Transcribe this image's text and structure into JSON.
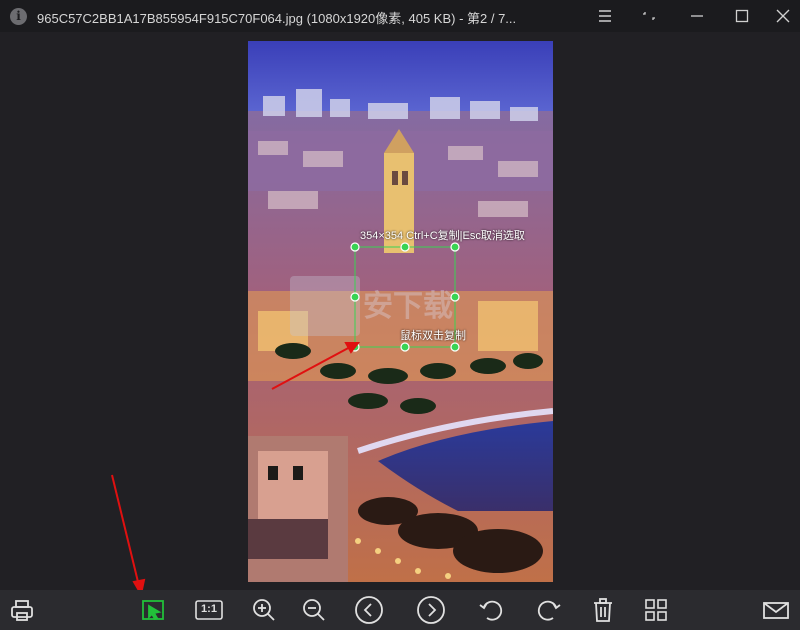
{
  "window": {
    "title": "965C57C2BB1A17B855954F915C70F064.jpg (1080x1920像素, 405 KB) - 第2 / 7...",
    "controls": [
      "menu-icon",
      "compact-icon",
      "minimize-icon",
      "maximize-icon",
      "close-icon"
    ]
  },
  "image": {
    "subject": "night-city-harbor-photo"
  },
  "selection": {
    "info_text": "354×354  Ctrl+C复制|Esc取消选取",
    "hint_text": "鼠标双击复制",
    "handle_color": "#2ecc40",
    "border_color": "#39d353"
  },
  "annotations": {
    "arrow_color": "#e01010"
  },
  "toolbar": {
    "active_color": "#22c03a",
    "actual_size_label": "1:1",
    "items": [
      "print-icon",
      "select-icon",
      "actual-size-icon",
      "zoom-in-icon",
      "zoom-out-icon",
      "previous-icon",
      "next-icon",
      "rotate-left-icon",
      "rotate-right-icon",
      "delete-icon",
      "grid-icon",
      "mail-icon"
    ]
  },
  "colors": {
    "background": "#212024",
    "titlebar": "#1b1b1e",
    "toolbar": "#2b2b2f",
    "icon": "#e0e0e0"
  }
}
